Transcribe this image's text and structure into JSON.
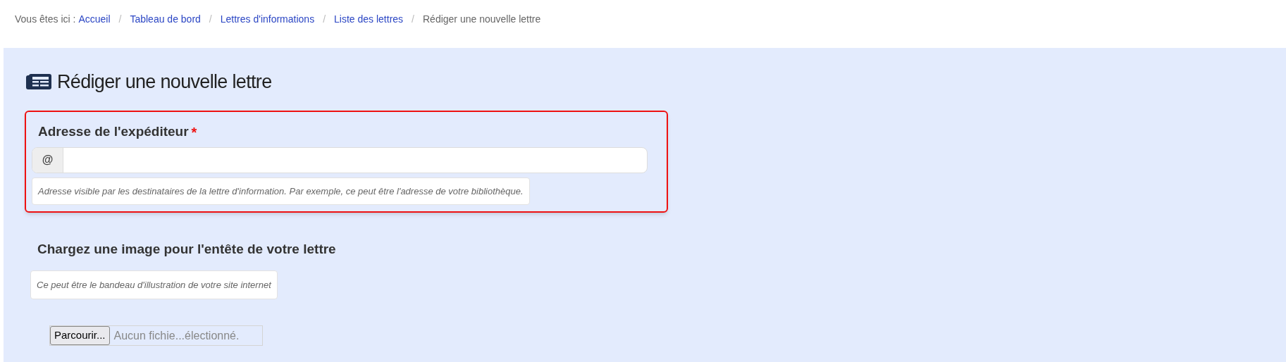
{
  "breadcrumb": {
    "prefix": "Vous êtes ici :",
    "separator": "/",
    "items": [
      {
        "label": "Accueil",
        "kind": "link"
      },
      {
        "label": "Tableau de bord",
        "kind": "link"
      },
      {
        "label": "Lettres d'informations",
        "kind": "link"
      },
      {
        "label": "Liste des lettres",
        "kind": "link"
      },
      {
        "label": "Rédiger une nouvelle lettre",
        "kind": "current"
      }
    ]
  },
  "page_title": "Rédiger une nouvelle lettre",
  "sender_field": {
    "label": "Adresse de l'expéditeur",
    "required": true,
    "required_mark": "*",
    "addon": "@",
    "help": "Adresse visible par les destinataires de la lettre d'information. Par exemple, ce peut être l'adresse de votre bibliothèque.",
    "highlighted": true
  },
  "header_image": {
    "label": "Chargez une image pour l'entête de votre lettre",
    "help": "Ce peut être le bandeau d'illustration de votre site internet",
    "browse_button": "Parcourir...",
    "file_status": "Aucun fichie...électionné."
  }
}
